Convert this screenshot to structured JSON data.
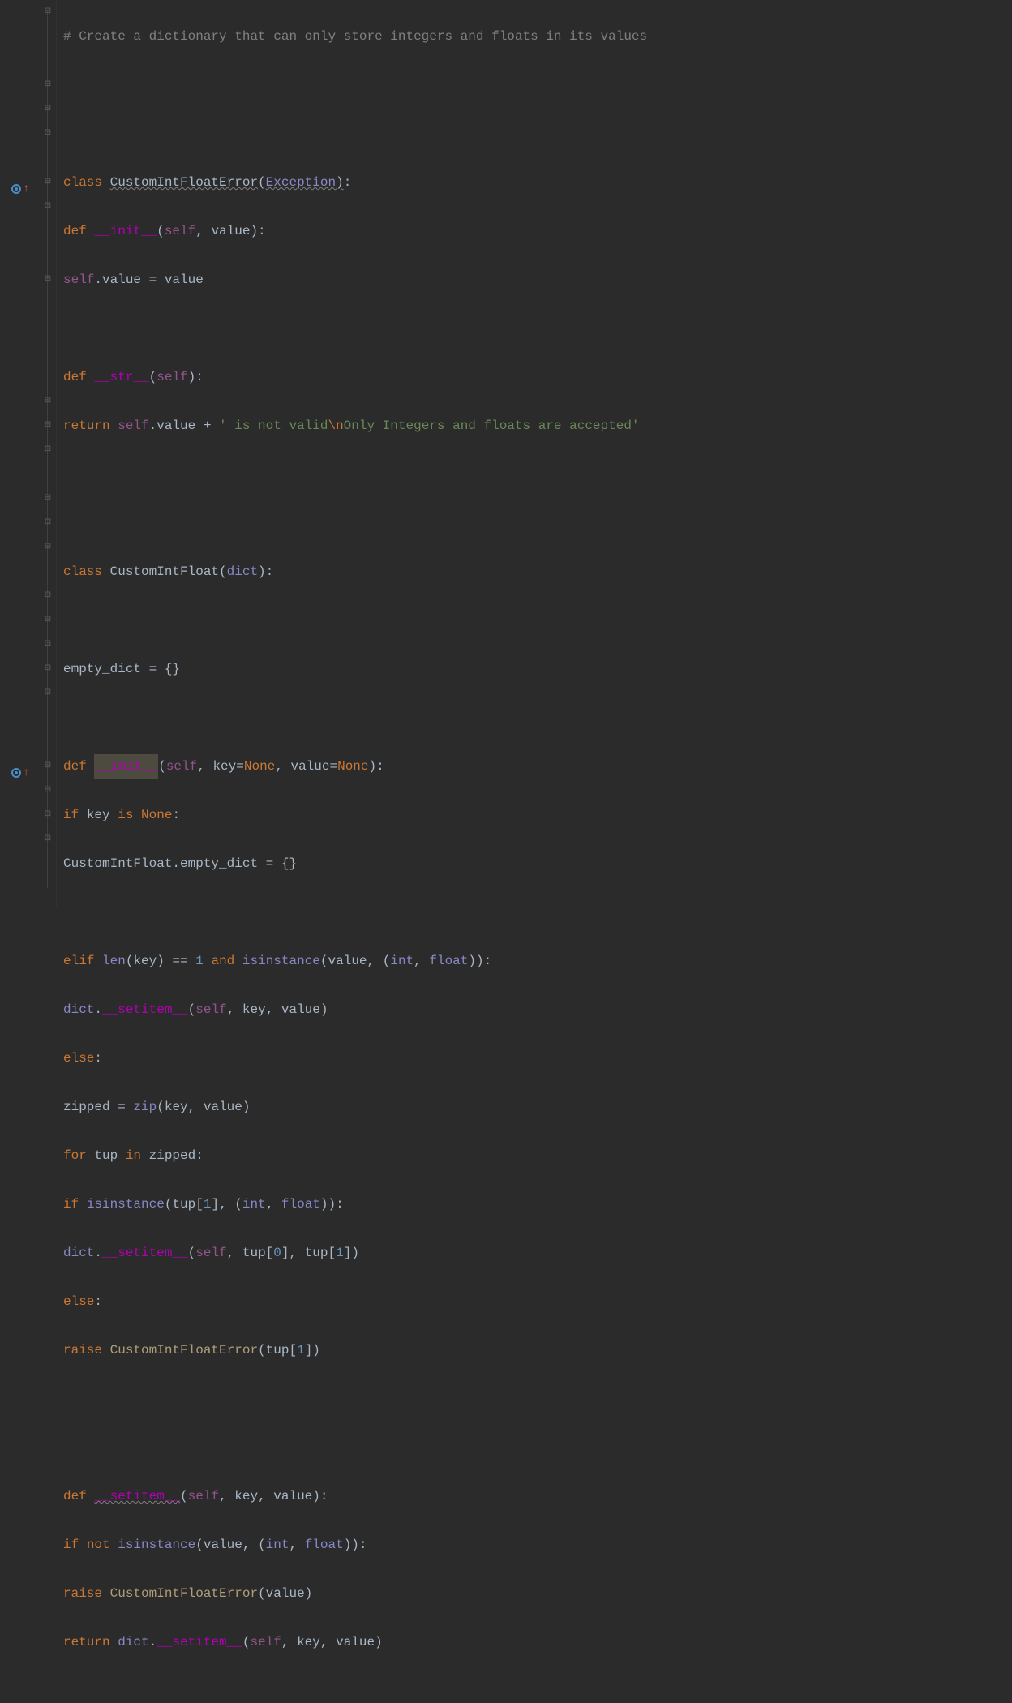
{
  "code": {
    "l1": {
      "comment": "# Create a dictionary that can only store integers and floats in its values"
    },
    "l4": {
      "kw_class": "class ",
      "name": "CustomIntFloatError",
      "base": "Exception"
    },
    "l5": {
      "kw_def": "def ",
      "dunder": "__init__",
      "p_self": "self",
      "p2": "value"
    },
    "l6": {
      "self": "self",
      "attr": ".value ",
      "op": "= ",
      "val": "value"
    },
    "l8": {
      "kw_def": "def ",
      "dunder": "__str__",
      "p_self": "self"
    },
    "l9": {
      "kw_return": "return ",
      "self": "self",
      "attr": ".value ",
      "op": "+ ",
      "str1": "' is not valid",
      "esc": "\\n",
      "str2": "Only Integers and floats are accepted'"
    },
    "l12": {
      "kw_class": "class ",
      "name": "CustomIntFloat",
      "base": "dict"
    },
    "l14": {
      "var": "empty_dict ",
      "op": "= ",
      "val": "{}"
    },
    "l16": {
      "kw_def": "def ",
      "dunder": "__init__",
      "p_self": "self",
      "p2": "key",
      "d2": "None",
      "p3": "value",
      "d3": "None"
    },
    "l17": {
      "kw_if": "if ",
      "var": "key ",
      "kw_is": "is ",
      "none": "None"
    },
    "l18": {
      "cls": "CustomIntFloat",
      "attr": ".empty_dict ",
      "op": "= ",
      "val": "{}"
    },
    "l20": {
      "kw_elif": "elif ",
      "fn": "len",
      "arg": "key",
      "op1": " == ",
      "num": "1",
      "kw_and": " and ",
      "fn2": "isinstance",
      "arg2a": "value",
      "arg2b": "int",
      "arg2c": "float"
    },
    "l21": {
      "cls": "dict",
      "dot": ".",
      "dunder": "__setitem__",
      "p_self": "self",
      "p2": "key",
      "p3": "value"
    },
    "l22": {
      "kw_else": "else"
    },
    "l23": {
      "var": "zipped ",
      "op": "= ",
      "fn": "zip",
      "a1": "key",
      "a2": "value"
    },
    "l24": {
      "kw_for": "for ",
      "var": "tup ",
      "kw_in": "in ",
      "it": "zipped"
    },
    "l25": {
      "kw_if": "if ",
      "fn": "isinstance",
      "arg1": "tup",
      "idx": "1",
      "arg2": "int",
      "arg3": "float"
    },
    "l26": {
      "cls": "dict",
      "dot": ".",
      "dunder": "__setitem__",
      "p_self": "self",
      "a1": "tup",
      "i1": "0",
      "a2": "tup",
      "i2": "1"
    },
    "l27": {
      "kw_else": "else"
    },
    "l28": {
      "kw_raise": "raise ",
      "cls": "CustomIntFloatError",
      "arg": "tup",
      "idx": "1"
    },
    "l31": {
      "kw_def": "def ",
      "dunder": "__setitem__",
      "p_self": "self",
      "p2": "key",
      "p3": "value"
    },
    "l32": {
      "kw_if": "if ",
      "kw_not": "not ",
      "fn": "isinstance",
      "a1": "value",
      "a2": "int",
      "a3": "float"
    },
    "l33": {
      "kw_raise": "raise ",
      "cls": "CustomIntFloatError",
      "arg": "value"
    },
    "l34": {
      "kw_return": "return ",
      "cls": "dict",
      "dot": ".",
      "dunder": "__setitem__",
      "p_self": "self",
      "p2": "key",
      "p3": "value"
    }
  }
}
